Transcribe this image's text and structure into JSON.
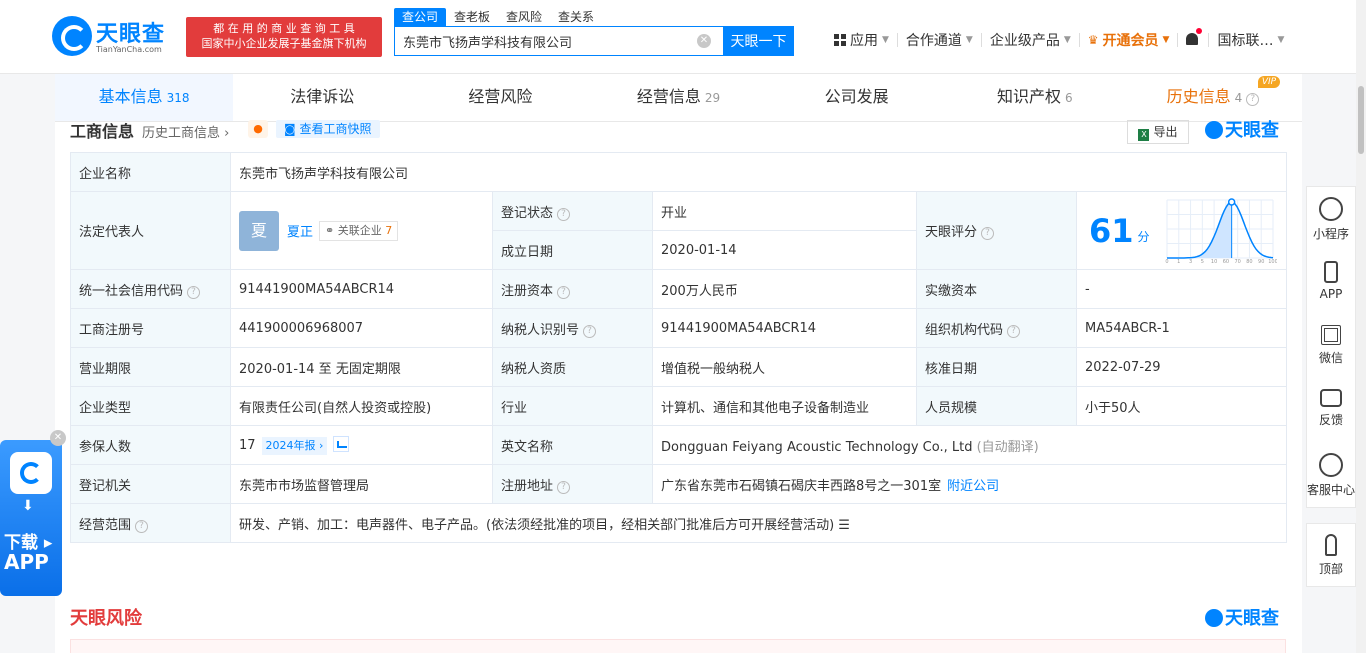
{
  "header": {
    "logo_text": "天眼查",
    "logo_sub": "TianYanCha.com",
    "slogan_line1": "都 在 用 的 商 业 查 询 工 具",
    "slogan_line2": "国家中小企业发展子基金旗下机构",
    "search_tabs": [
      "查公司",
      "查老板",
      "查风险",
      "查关系"
    ],
    "search_value": "东莞市飞扬声学科技有限公司",
    "search_button": "天眼一下",
    "nav": {
      "apps": "应用",
      "channels": "合作通道",
      "enterprise": "企业级产品",
      "vip": "开通会员",
      "intl": "国标联…"
    }
  },
  "tabs": [
    {
      "label": "基本信息",
      "count": "318"
    },
    {
      "label": "法律诉讼",
      "count": ""
    },
    {
      "label": "经营风险",
      "count": ""
    },
    {
      "label": "经营信息",
      "count": "29"
    },
    {
      "label": "公司发展",
      "count": ""
    },
    {
      "label": "知识产权",
      "count": "6"
    },
    {
      "label": "历史信息",
      "count": "4",
      "badge": "VIP"
    }
  ],
  "section": {
    "title": "工商信息",
    "history_link": "历史工商信息",
    "snapshot_button": "查看工商快照",
    "export_button": "导出",
    "brand": "天眼查"
  },
  "info": {
    "company_name_label": "企业名称",
    "company_name": "东莞市飞扬声学科技有限公司",
    "legal_rep_label": "法定代表人",
    "legal_rep_avatar": "夏",
    "legal_rep_name": "夏正",
    "assoc_label": "关联企业",
    "assoc_count": "7",
    "reg_status_label": "登记状态",
    "reg_status": "开业",
    "found_date_label": "成立日期",
    "found_date": "2020-01-14",
    "score_label": "天眼评分",
    "score_value": "61",
    "score_unit": "分",
    "credit_code_label": "统一社会信用代码",
    "credit_code": "91441900MA54ABCR14",
    "reg_capital_label": "注册资本",
    "reg_capital": "200万人民币",
    "paid_capital_label": "实缴资本",
    "paid_capital": "-",
    "biz_reg_no_label": "工商注册号",
    "biz_reg_no": "441900006968007",
    "taxpayer_id_label": "纳税人识别号",
    "taxpayer_id": "91441900MA54ABCR14",
    "org_code_label": "组织机构代码",
    "org_code": "MA54ABCR-1",
    "term_label": "营业期限",
    "term": "2020-01-14 至 无固定期限",
    "taxpayer_qual_label": "纳税人资质",
    "taxpayer_qual": "增值税一般纳税人",
    "approval_date_label": "核准日期",
    "approval_date": "2022-07-29",
    "company_type_label": "企业类型",
    "company_type": "有限责任公司(自然人投资或控股)",
    "industry_label": "行业",
    "industry": "计算机、通信和其他电子设备制造业",
    "staff_size_label": "人员规模",
    "staff_size": "小于50人",
    "insured_label": "参保人数",
    "insured": "17",
    "insured_year": "2024年报",
    "english_name_label": "英文名称",
    "english_name": "Dongguan Feiyang Acoustic Technology Co., Ltd",
    "english_name_note": "(自动翻译)",
    "reg_authority_label": "登记机关",
    "reg_authority": "东莞市市场监督管理局",
    "reg_address_label": "注册地址",
    "reg_address": "广东省东莞市石碣镇石碣庆丰西路8号之一301室",
    "nearby_link": "附近公司",
    "scope_label": "经营范围",
    "scope": "研发、产销、加工：电声器件、电子产品。(依法须经批准的项目，经相关部门批准后方可开展经营活动)"
  },
  "score_chart": {
    "x_ticks": [
      "0",
      "1",
      "3",
      "5",
      "10",
      "60",
      "70",
      "80",
      "90",
      "100"
    ],
    "marker": 61
  },
  "risk": {
    "title": "天眼风险",
    "brand": "天眼查"
  },
  "sidebar": {
    "items": [
      "小程序",
      "APP",
      "微信",
      "反馈",
      "客服中心"
    ],
    "top": "顶部"
  },
  "app_promo": {
    "line1": "下载",
    "line2": "APP"
  },
  "colors": {
    "brand_blue": "#0084ff",
    "open_green": "#11a659",
    "vip_orange": "#e8710a",
    "risk_red": "#e23c3c"
  }
}
